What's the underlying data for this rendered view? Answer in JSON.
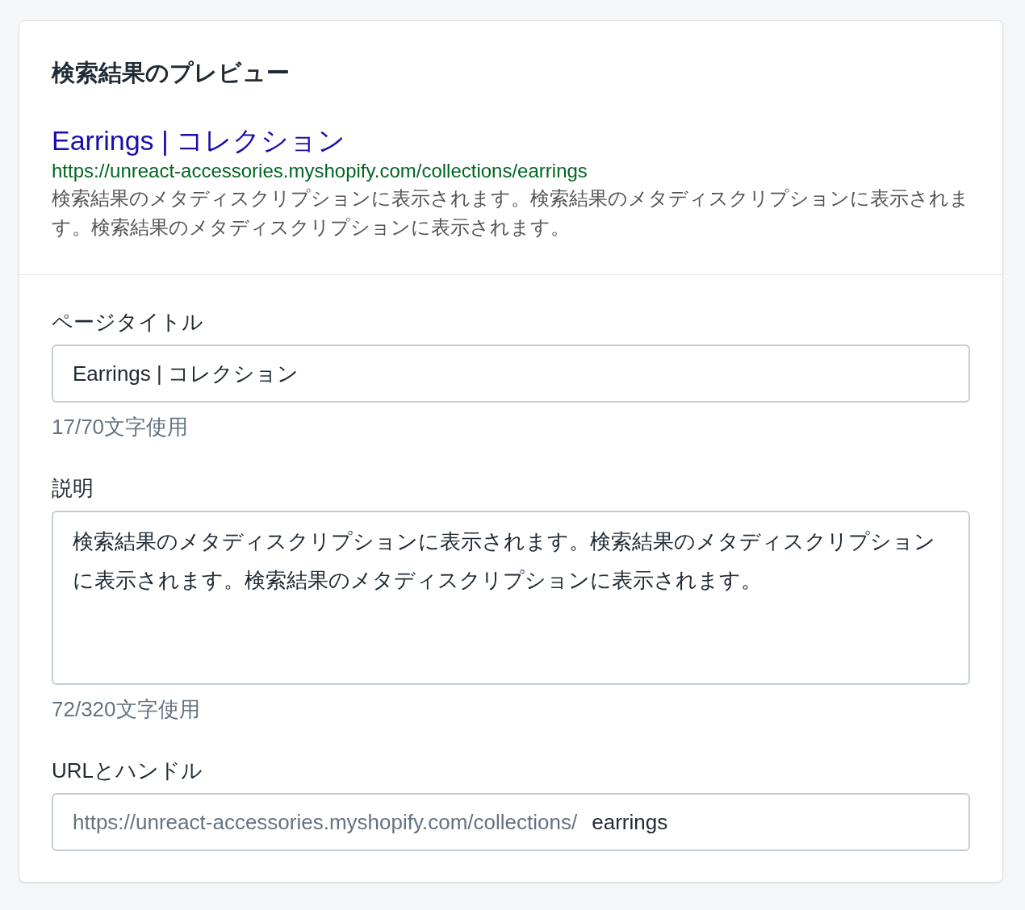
{
  "card": {
    "title": "検索結果のプレビュー",
    "preview": {
      "title": "Earrings | コレクション",
      "url": "https://unreact-accessories.myshopify.com/collections/earrings",
      "description": "検索結果のメタディスクリプションに表示されます。検索結果のメタディスクリプションに表示されます。検索結果のメタディスクリプションに表示されます。"
    },
    "fields": [
      {
        "kind": "input",
        "label": "ページタイトル",
        "value": "Earrings | コレクション",
        "help": "17/70文字使用"
      },
      {
        "kind": "textarea",
        "label": "説明",
        "value": "検索結果のメタディスクリプションに表示されます。検索結果のメタディスクリプションに表示されます。検索結果のメタディスクリプションに表示されます。",
        "help": "72/320文字使用"
      },
      {
        "kind": "prefixed",
        "label": "URLとハンドル",
        "prefix": "https://unreact-accessories.myshopify.com/collections/",
        "value": "earrings"
      }
    ]
  }
}
